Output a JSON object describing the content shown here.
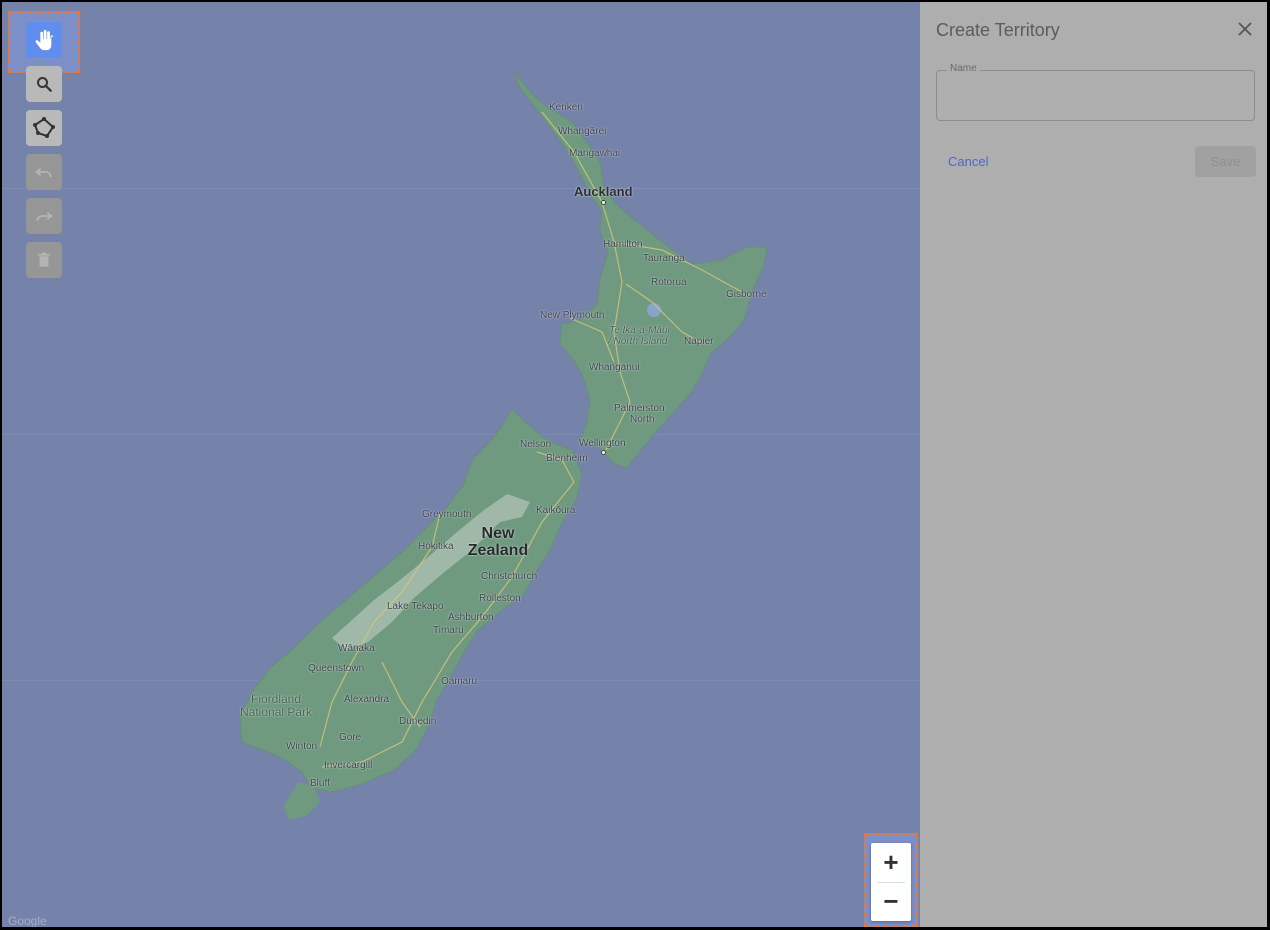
{
  "panel": {
    "title": "Create Territory",
    "name_label": "Name",
    "name_value": "",
    "cancel_label": "Cancel",
    "save_label": "Save"
  },
  "toolbar": {
    "tools": [
      {
        "name": "pan",
        "icon": "hand-icon",
        "state": "active"
      },
      {
        "name": "search",
        "icon": "search-icon",
        "state": "enabled"
      },
      {
        "name": "draw",
        "icon": "polygon-icon",
        "state": "enabled"
      },
      {
        "name": "undo",
        "icon": "undo-icon",
        "state": "disabled"
      },
      {
        "name": "redo",
        "icon": "redo-icon",
        "state": "disabled"
      },
      {
        "name": "delete",
        "icon": "trash-icon",
        "state": "disabled"
      }
    ]
  },
  "zoom": {
    "in_label": "+",
    "out_label": "−"
  },
  "map": {
    "places": {
      "kerikeri": "Kerikeri",
      "whangarei": "Whangārei",
      "mangawhai": "Mangawhai",
      "auckland": "Auckland",
      "hamilton": "Hamilton",
      "tauranga": "Tauranga",
      "rotorua": "Rotorua",
      "gisborne": "Gisborne",
      "new_plymouth": "New Plymouth",
      "north_island_1": "Te Ika-a-Māui",
      "north_island_2": "/ North Island",
      "napier": "Napier",
      "whanganui": "Whanganui",
      "palmerston_1": "Palmerston",
      "palmerston_2": "North",
      "wellington": "Wellington",
      "nelson": "Nelson",
      "blenheim": "Blenheim",
      "kaikoura": "Kaikōura",
      "greymouth": "Greymouth",
      "hokitika": "Hokitika",
      "country_1": "New",
      "country_2": "Zealand",
      "christchurch": "Christchurch",
      "rolleston": "Rolleston",
      "lake_tekapo": "Lake Tekapo",
      "ashburton": "Ashburton",
      "timaru": "Timaru",
      "wanaka": "Wānaka",
      "queenstown": "Queenstown",
      "oamaru": "Oamaru",
      "fiordland_1": "Fiordland",
      "fiordland_2": "National Park",
      "alexandra": "Alexandra",
      "dunedin": "Dunedin",
      "gore": "Gore",
      "winton": "Winton",
      "invercargill": "Invercargill",
      "bluff": "Bluff"
    },
    "watermark": "Google"
  },
  "colors": {
    "ocean": "#7582aa",
    "land": "#6f9a80",
    "active_tool": "#5f8eef",
    "highlight_border": "#e6783a",
    "panel_bg": "#aeaeae",
    "cancel": "#4f67c9"
  }
}
